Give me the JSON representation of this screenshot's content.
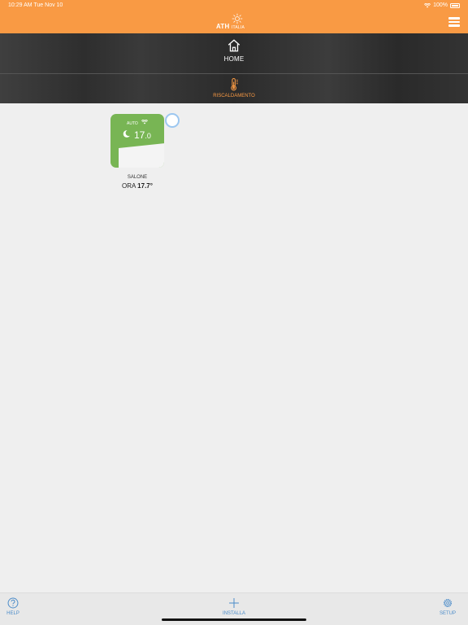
{
  "status_bar": {
    "time_date": "10:29 AM   Tue Nov 10",
    "battery": "100%",
    "wifi_icon": "wifi-icon",
    "battery_icon": "battery-icon"
  },
  "header": {
    "logo_text": "ATH",
    "logo_sub": "ITALIA",
    "menu_icon": "hamburger-menu-icon",
    "background_color": "#f99a44"
  },
  "tabs": {
    "home": {
      "label": "HOME",
      "icon": "home-icon"
    },
    "heating": {
      "label": "RISCALDAMENTO",
      "icon": "thermometer-icon",
      "color": "#f99a44"
    }
  },
  "devices": [
    {
      "mode": "AUTO",
      "setpoint_int": "17",
      "setpoint_dec": ".0",
      "name": "SALONE",
      "current_prefix": "ORA",
      "current_temp": "17.7°",
      "tile_color": "#78b554",
      "icons": [
        "moon-icon",
        "wifi-icon"
      ]
    }
  ],
  "bottom_bar": {
    "help": {
      "label": "HELP",
      "icon": "help-icon"
    },
    "install": {
      "label": "INSTALLA",
      "icon": "plus-icon"
    },
    "setup": {
      "label": "SETUP",
      "icon": "gear-icon"
    },
    "accent_color": "#4a8bc9"
  }
}
